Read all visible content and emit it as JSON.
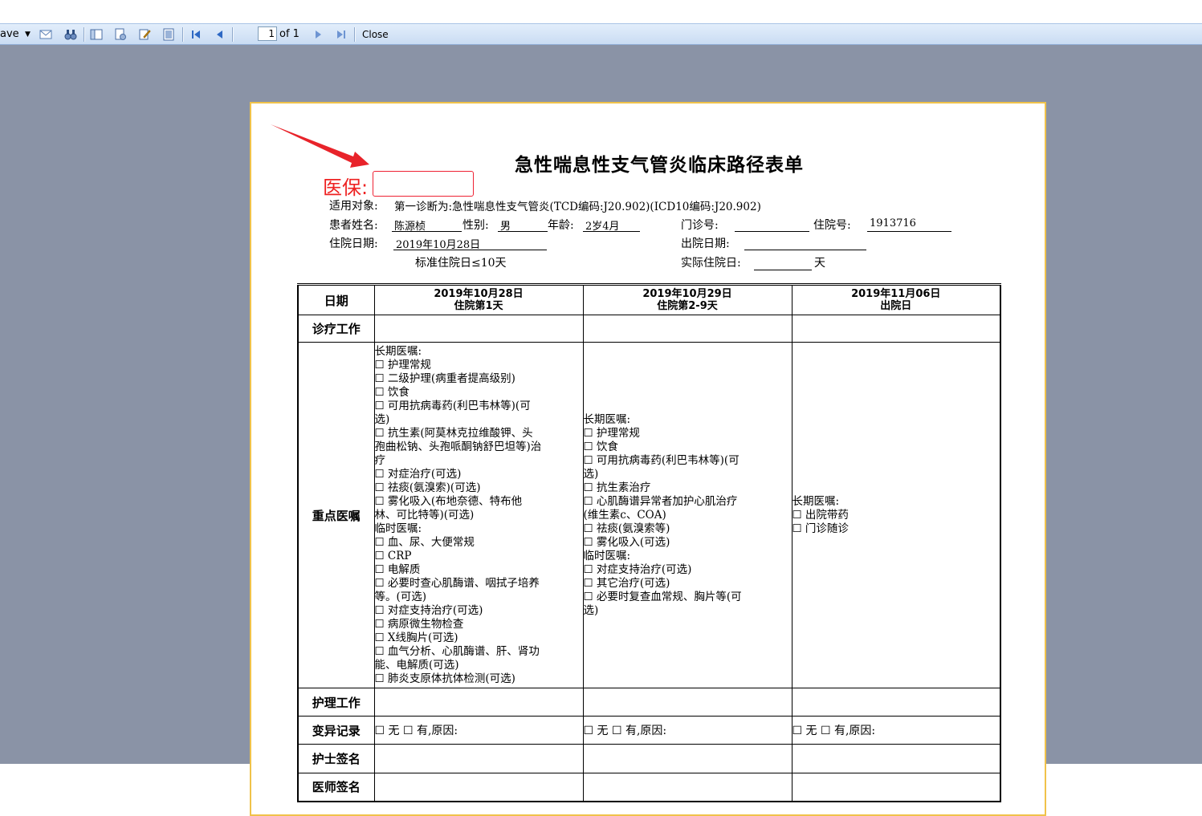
{
  "toolbar": {
    "save_label": "ave",
    "page_value": "1",
    "page_of": "of 1",
    "close_label": "Close"
  },
  "annotation": {
    "yibao_label": "医保:",
    "arrow_color": "#e8232a"
  },
  "document": {
    "title": "急性喘息性支气管炎临床路径表单",
    "applies_label": "适用对象:",
    "applies_value": "第一诊断为:急性喘息性支气管炎(TCD编码:J20.902)(ICD10编码:J20.902)",
    "name_label": "患者姓名:",
    "name_value": "陈源桢",
    "sex_label": "性别:",
    "sex_value": "男",
    "age_label": "年龄:",
    "age_value": "2岁4月",
    "clinic_label": "门诊号:",
    "clinic_value": "",
    "inpatient_label": "住院号:",
    "inpatient_value": "1913716",
    "admit_label": "住院日期:",
    "admit_value": "2019年10月28日",
    "discharge_label": "出院日期:",
    "discharge_value": "",
    "std_stay": "标准住院日≤10天",
    "actual_label": "实际住院日:",
    "actual_value": "",
    "actual_unit": "天"
  },
  "table": {
    "date_label": "日期",
    "columns": [
      {
        "date": "2019年10月28日",
        "sub": "住院第1天"
      },
      {
        "date": "2019年10月29日",
        "sub": "住院第2-9天"
      },
      {
        "date": "2019年11月06日",
        "sub": "出院日"
      }
    ],
    "row_labels": {
      "diag": "诊疗工作",
      "orders": "重点医嘱",
      "nursing": "护理工作",
      "variance": "变异记录",
      "nurse_sign": "护士签名",
      "doctor_sign": "医师签名"
    },
    "orders": [
      [
        "长期医嘱:",
        "☐ 护理常规",
        "☐ 二级护理(病重者提高级别)",
        "☐ 饮食",
        "☐ 可用抗病毒药(利巴韦林等)(可",
        "选)",
        "☐ 抗生素(阿莫林克拉维酸钾、头",
        "孢曲松钠、头孢哌酮钠舒巴坦等)治",
        "疗",
        "☐ 对症治疗(可选)",
        "☐ 祛痰(氨溴索)(可选)",
        "☐ 雾化吸入(布地奈德、特布他",
        "林、可比特等)(可选)",
        "临时医嘱:",
        "☐ 血、尿、大便常规",
        "☐ CRP",
        "☐ 电解质",
        "☐ 必要时查心肌酶谱、咽拭子培养",
        "等。(可选)",
        "☐ 对症支持治疗(可选)",
        "☐ 病原微生物检查",
        "☐ X线胸片(可选)",
        "☐ 血气分析、心肌酶谱、肝、肾功",
        "能、电解质(可选)",
        "☐ 肺炎支原体抗体检测(可选)"
      ],
      [
        "长期医嘱:",
        "☐ 护理常规",
        "☐ 饮食",
        "☐ 可用抗病毒药(利巴韦林等)(可",
        "选)",
        "☐ 抗生素治疗",
        "☐ 心肌酶谱异常者加护心肌治疗",
        "(维生素c、COA)",
        "☐ 祛痰(氨溴索等)",
        "☐ 雾化吸入(可选)",
        "临时医嘱:",
        "☐ 对症支持治疗(可选)",
        "☐ 其它治疗(可选)",
        "☐ 必要时复查血常规、胸片等(可",
        "选)"
      ],
      [
        "长期医嘱:",
        "☐ 出院带药",
        "☐ 门诊随诊"
      ]
    ],
    "variance_text": "☐ 无 ☐ 有,原因:"
  }
}
